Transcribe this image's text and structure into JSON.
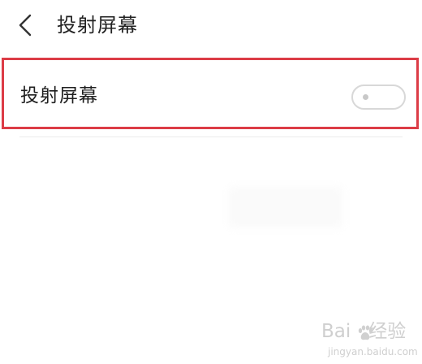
{
  "header": {
    "back_icon": "chevron-left-icon",
    "title": "投射屏幕"
  },
  "settings": {
    "rows": [
      {
        "label": "投射屏幕",
        "toggle_on": false
      }
    ]
  },
  "watermark": {
    "main_prefix": "Bai",
    "main_suffix": "经验",
    "paw_icon": "paw-icon",
    "sub": "jingyan.baidu.com"
  },
  "colors": {
    "highlight_border": "#dc3c46",
    "toggle_border": "#d8d8d8",
    "watermark": "#cfcfcf"
  }
}
